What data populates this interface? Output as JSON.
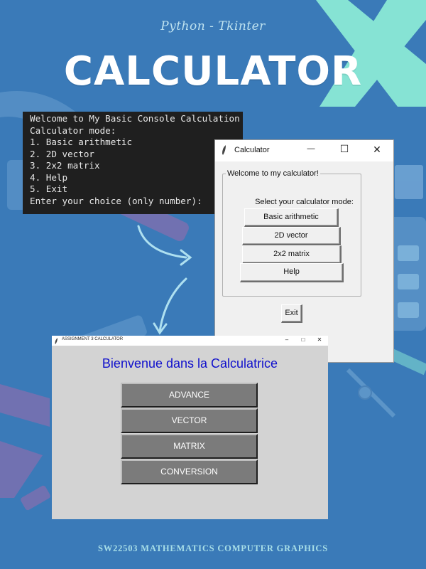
{
  "poster": {
    "subtitle": "Python - Tkinter",
    "title": "CALCULATOR",
    "footer": "SW22503 MATHEMATICS COMPUTER GRAPHICS"
  },
  "console": {
    "lines": [
      "Welcome to My Basic Console Calculation",
      "Calculator mode:",
      "1. Basic arithmetic",
      "2. 2D vector",
      "3. 2x2 matrix",
      "4. Help",
      "5. Exit",
      "Enter your choice (only number):"
    ]
  },
  "window_calculator": {
    "title": "Calculator",
    "group_label": "Welcome to my calculator!",
    "mode_label": "Select your calculator mode:",
    "buttons": [
      "Basic arithmetic",
      "2D vector",
      "2x2 matrix",
      "Help"
    ],
    "exit_label": "Exit",
    "controls": {
      "minimize": "—",
      "maximize": "☐",
      "close": "✕"
    }
  },
  "window_assignment": {
    "title": "ASSIGNMENT 3 CALCULATOR",
    "welcome": "Bienvenue dans la Calculatrice",
    "buttons": [
      "ADVANCE",
      "VECTOR",
      "MATRIX",
      "CONVERSION"
    ],
    "controls": {
      "minimize": "–",
      "maximize": "□",
      "close": "✕"
    }
  },
  "colors": {
    "background": "#3a7ab8",
    "accent_teal": "#86e3d4",
    "accent_purple": "#7b6fb0",
    "welcome_text": "#1010cc",
    "french_button": "#7b7b7b"
  }
}
